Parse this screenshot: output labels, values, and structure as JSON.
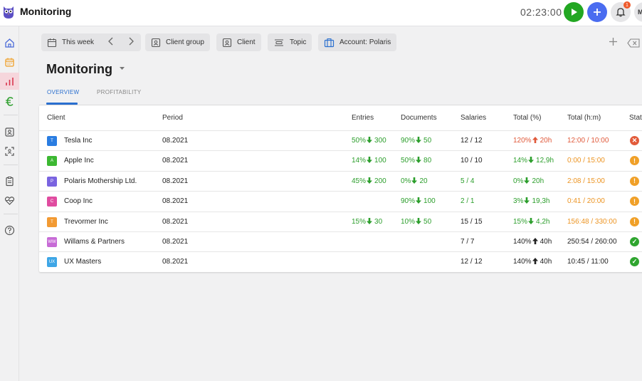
{
  "app": {
    "title": "Monitoring",
    "timer": "02:23:00",
    "notification_count": "1",
    "avatar_initial": "M"
  },
  "filters": {
    "week": "This week",
    "client_group": "Client group",
    "client": "Client",
    "topic": "Topic",
    "account": "Account: Polaris"
  },
  "page": {
    "title": "Monitoring",
    "tabs": [
      "OVERVIEW",
      "PROFITABILITY"
    ]
  },
  "table": {
    "headers": [
      "Client",
      "Period",
      "Entries",
      "Documents",
      "Salaries",
      "Total (%)",
      "Total (h:m)",
      "Stat"
    ],
    "rows": [
      {
        "initials": "T",
        "color": "#2a7de1",
        "client": "Tesla Inc",
        "period": "08.2021",
        "entries_pct": "50%",
        "entries_val": "300",
        "entries_dir": "down",
        "docs_pct": "90%",
        "docs_val": "50",
        "docs_dir": "down",
        "salaries": "12 / 12",
        "total_pct": "120%",
        "total_val": "20h",
        "total_dir": "up",
        "total_hm": "12:00 / 10:00",
        "tone": "bad",
        "status": "error"
      },
      {
        "initials": "A",
        "color": "#3cb832",
        "client": "Apple Inc",
        "period": "08.2021",
        "entries_pct": "14%",
        "entries_val": "100",
        "entries_dir": "down",
        "docs_pct": "50%",
        "docs_val": "80",
        "docs_dir": "down",
        "salaries": "10 / 10",
        "total_pct": "14%",
        "total_val": "12,9h",
        "total_dir": "down",
        "total_hm": "0:00 / 15:00",
        "tone": "warn",
        "status": "warning"
      },
      {
        "initials": "P",
        "color": "#7a64e0",
        "client": "Polaris Mothership Ltd.",
        "period": "08.2021",
        "entries_pct": "45%",
        "entries_val": "200",
        "entries_dir": "down",
        "docs_pct": "0%",
        "docs_val": "20",
        "docs_dir": "down",
        "salaries": "5 / 4",
        "total_pct": "0%",
        "total_val": "20h",
        "total_dir": "down",
        "total_hm": "2:08 / 15:00",
        "tone": "warn",
        "status": "warning"
      },
      {
        "initials": "C",
        "color": "#e04ca0",
        "client": "Coop Inc",
        "period": "08.2021",
        "entries_pct": "",
        "entries_val": "",
        "entries_dir": "",
        "docs_pct": "90%",
        "docs_val": "100",
        "docs_dir": "down",
        "salaries": "2 / 1",
        "total_pct": "3%",
        "total_val": "19,3h",
        "total_dir": "down",
        "total_hm": "0:41 / 20:00",
        "tone": "warn",
        "status": "warning"
      },
      {
        "initials": "T",
        "color": "#f29a33",
        "client": "Trevormer Inc",
        "period": "08.2021",
        "entries_pct": "15%",
        "entries_val": "30",
        "entries_dir": "down",
        "docs_pct": "10%",
        "docs_val": "50",
        "docs_dir": "down",
        "salaries": "15 / 15",
        "total_pct": "15%",
        "total_val": "4,2h",
        "total_dir": "down",
        "total_hm": "156:48 / 330:00",
        "tone": "warn",
        "status": "warning"
      },
      {
        "initials": "WW",
        "color": "#c76bd6",
        "client": "Willams & Partners",
        "period": "08.2021",
        "entries_pct": "",
        "entries_val": "",
        "entries_dir": "",
        "docs_pct": "",
        "docs_val": "",
        "docs_dir": "",
        "salaries": "7 / 7",
        "total_pct": "140%",
        "total_val": "40h",
        "total_dir": "up",
        "total_hm": "250:54 / 260:00",
        "tone": "ok",
        "status": "ok"
      },
      {
        "initials": "UX",
        "color": "#3ea6e6",
        "client": "UX Masters",
        "period": "08.2021",
        "entries_pct": "",
        "entries_val": "",
        "entries_dir": "",
        "docs_pct": "",
        "docs_val": "",
        "docs_dir": "",
        "salaries": "12 / 12",
        "total_pct": "140%",
        "total_val": "40h",
        "total_dir": "up",
        "total_hm": "10:45 / 11:00",
        "tone": "ok",
        "status": "ok"
      }
    ]
  }
}
